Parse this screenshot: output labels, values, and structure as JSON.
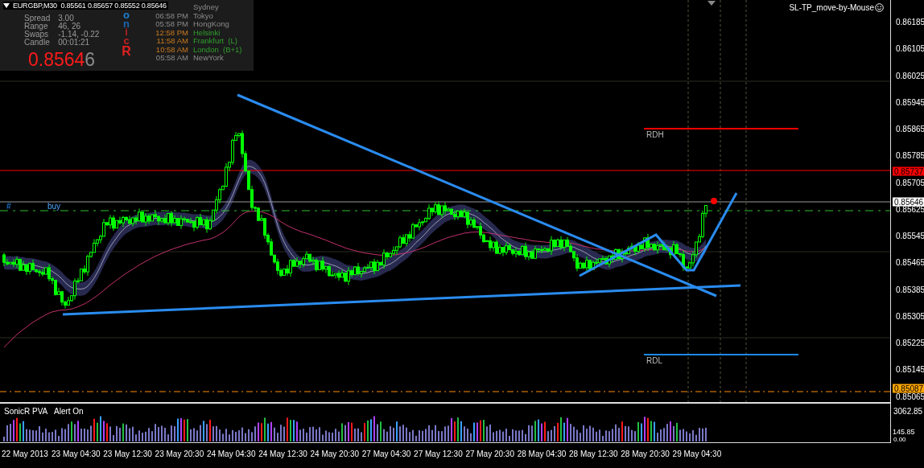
{
  "chart": {
    "header": "EURGBP,M30  0.85561 0.85657 0.85552 0.85646",
    "expert": "SL-TP_move-by-Mouse",
    "order_prefix": "#",
    "order_label": "buy",
    "levels": [
      {
        "label": "RDH",
        "color": "#ff0000"
      },
      {
        "label": "RDL",
        "color": "#1e88e5"
      }
    ]
  },
  "info": {
    "stats": [
      {
        "label": "Spread",
        "value": "3.00"
      },
      {
        "label": "Range",
        "value": "46, 26"
      },
      {
        "label": "Swaps",
        "value": "-1.14, -0.22"
      },
      {
        "label": "Candle",
        "value": "00:01:21"
      }
    ],
    "price_main": "0.8564",
    "price_last": "6",
    "sonic_letters": [
      {
        "char": "o",
        "color": "#1e7fd0"
      },
      {
        "char": "n",
        "color": "#1a66b0"
      },
      {
        "char": "i",
        "color": "#b02020"
      },
      {
        "char": "c",
        "color": "#c82020"
      },
      {
        "char": "R",
        "color": "#e02020"
      }
    ],
    "sessions": [
      {
        "city": "Sydney",
        "open": false
      },
      {
        "time": "06:58 PM",
        "city": "Tokyo",
        "open": false
      },
      {
        "time": "05:58 PM",
        "city": "HongKong",
        "open": false
      },
      {
        "time": "12:58 PM",
        "city": "Helsinki",
        "open": true
      },
      {
        "time": "11:58 AM",
        "city": "Frankfurt  (L)",
        "open": true
      },
      {
        "time": "10:58 AM",
        "city": "London  (B+1)",
        "open": true
      },
      {
        "time": "05:58 AM",
        "city": "NewYork",
        "open": false
      }
    ]
  },
  "price_axis": {
    "ticks": [
      "0.86185",
      "0.86105",
      "0.86025",
      "0.85945",
      "0.85865",
      "0.85785",
      "0.85705",
      "0.85625",
      "0.85545",
      "0.85465",
      "0.85385",
      "0.85305",
      "0.85225",
      "0.85145",
      "0.85065"
    ],
    "tags": [
      {
        "text": "0.85737",
        "color": "#ff0000"
      },
      {
        "text": "0.85646",
        "color": "#ffffff"
      },
      {
        "text": "0.85087",
        "color": "#ffa500"
      }
    ]
  },
  "indicator": {
    "name": "SonicR PVA",
    "alert": "Alert On",
    "axis": [
      "3062.85",
      "145.85",
      "0.00"
    ]
  },
  "time_axis": [
    "22 May 2013",
    "23 May 04:30",
    "23 May 12:30",
    "23 May 20:30",
    "24 May 04:30",
    "24 May 12:30",
    "24 May 20:30",
    "27 May 04:30",
    "27 May 12:30",
    "27 May 20:30",
    "28 May 04:30",
    "28 May 12:30",
    "28 May 20:30",
    "29 May 04:30"
  ]
}
